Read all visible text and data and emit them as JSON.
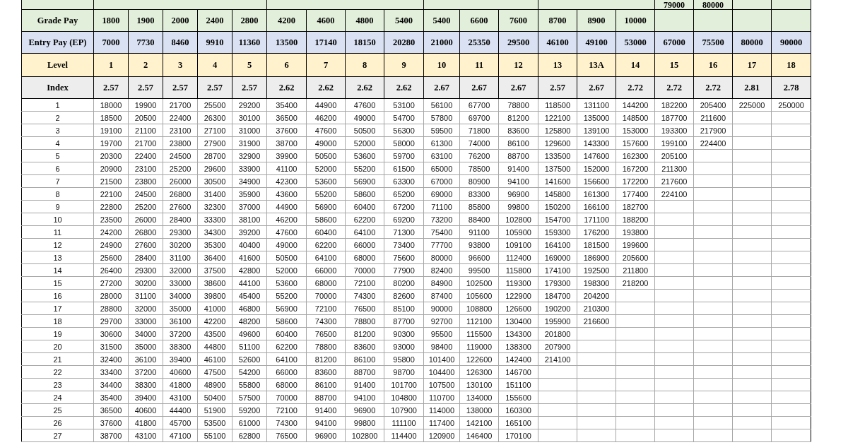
{
  "top_row": [
    "79000",
    "80000"
  ],
  "header_rows": [
    {
      "kind": "grade",
      "label": "Grade Pay",
      "values": [
        "1800",
        "1900",
        "2000",
        "2400",
        "2800",
        "4200",
        "4600",
        "4800",
        "5400",
        "5400",
        "6600",
        "7600",
        "8700",
        "8900",
        "10000"
      ]
    },
    {
      "kind": "entry",
      "label": "Entry Pay (EP)",
      "values": [
        "7000",
        "7730",
        "8460",
        "9910",
        "11360",
        "13500",
        "17140",
        "18150",
        "20280",
        "21000",
        "25350",
        "29500",
        "46100",
        "49100",
        "53000",
        "67000",
        "75500",
        "80000",
        "90000"
      ]
    },
    {
      "kind": "level",
      "label": "Level",
      "values": [
        "1",
        "2",
        "3",
        "4",
        "5",
        "6",
        "7",
        "8",
        "9",
        "10",
        "11",
        "12",
        "13",
        "13A",
        "14",
        "15",
        "16",
        "17",
        "18"
      ]
    },
    {
      "kind": "index",
      "label": "Index",
      "values": [
        "2.57",
        "2.57",
        "2.57",
        "2.57",
        "2.57",
        "2.62",
        "2.62",
        "2.62",
        "2.62",
        "2.67",
        "2.67",
        "2.67",
        "2.57",
        "2.67",
        "2.72",
        "2.72",
        "2.72",
        "2.81",
        "2.78"
      ]
    }
  ],
  "rows": [
    {
      "step": "1",
      "values": [
        "18000",
        "19900",
        "21700",
        "25500",
        "29200",
        "35400",
        "44900",
        "47600",
        "53100",
        "56100",
        "67700",
        "78800",
        "118500",
        "131100",
        "144200",
        "182200",
        "205400",
        "225000",
        "250000"
      ]
    },
    {
      "step": "2",
      "values": [
        "18500",
        "20500",
        "22400",
        "26300",
        "30100",
        "36500",
        "46200",
        "49000",
        "54700",
        "57800",
        "69700",
        "81200",
        "122100",
        "135000",
        "148500",
        "187700",
        "211600"
      ]
    },
    {
      "step": "3",
      "values": [
        "19100",
        "21100",
        "23100",
        "27100",
        "31000",
        "37600",
        "47600",
        "50500",
        "56300",
        "59500",
        "71800",
        "83600",
        "125800",
        "139100",
        "153000",
        "193300",
        "217900"
      ]
    },
    {
      "step": "4",
      "values": [
        "19700",
        "21700",
        "23800",
        "27900",
        "31900",
        "38700",
        "49000",
        "52000",
        "58000",
        "61300",
        "74000",
        "86100",
        "129600",
        "143300",
        "157600",
        "199100",
        "224400"
      ]
    },
    {
      "step": "5",
      "values": [
        "20300",
        "22400",
        "24500",
        "28700",
        "32900",
        "39900",
        "50500",
        "53600",
        "59700",
        "63100",
        "76200",
        "88700",
        "133500",
        "147600",
        "162300",
        "205100"
      ]
    },
    {
      "step": "6",
      "values": [
        "20900",
        "23100",
        "25200",
        "29600",
        "33900",
        "41100",
        "52000",
        "55200",
        "61500",
        "65000",
        "78500",
        "91400",
        "137500",
        "152000",
        "167200",
        "211300"
      ]
    },
    {
      "step": "7",
      "values": [
        "21500",
        "23800",
        "26000",
        "30500",
        "34900",
        "42300",
        "53600",
        "56900",
        "63300",
        "67000",
        "80900",
        "94100",
        "141600",
        "156600",
        "172200",
        "217600"
      ]
    },
    {
      "step": "8",
      "values": [
        "22100",
        "24500",
        "26800",
        "31400",
        "35900",
        "43600",
        "55200",
        "58600",
        "65200",
        "69000",
        "83300",
        "96900",
        "145800",
        "161300",
        "177400",
        "224100"
      ]
    },
    {
      "step": "9",
      "values": [
        "22800",
        "25200",
        "27600",
        "32300",
        "37000",
        "44900",
        "56900",
        "60400",
        "67200",
        "71100",
        "85800",
        "99800",
        "150200",
        "166100",
        "182700"
      ]
    },
    {
      "step": "10",
      "values": [
        "23500",
        "26000",
        "28400",
        "33300",
        "38100",
        "46200",
        "58600",
        "62200",
        "69200",
        "73200",
        "88400",
        "102800",
        "154700",
        "171100",
        "188200"
      ]
    },
    {
      "step": "11",
      "values": [
        "24200",
        "26800",
        "29300",
        "34300",
        "39200",
        "47600",
        "60400",
        "64100",
        "71300",
        "75400",
        "91100",
        "105900",
        "159300",
        "176200",
        "193800"
      ]
    },
    {
      "step": "12",
      "values": [
        "24900",
        "27600",
        "30200",
        "35300",
        "40400",
        "49000",
        "62200",
        "66000",
        "73400",
        "77700",
        "93800",
        "109100",
        "164100",
        "181500",
        "199600"
      ]
    },
    {
      "step": "13",
      "values": [
        "25600",
        "28400",
        "31100",
        "36400",
        "41600",
        "50500",
        "64100",
        "68000",
        "75600",
        "80000",
        "96600",
        "112400",
        "169000",
        "186900",
        "205600"
      ]
    },
    {
      "step": "14",
      "values": [
        "26400",
        "29300",
        "32000",
        "37500",
        "42800",
        "52000",
        "66000",
        "70000",
        "77900",
        "82400",
        "99500",
        "115800",
        "174100",
        "192500",
        "211800"
      ]
    },
    {
      "step": "15",
      "values": [
        "27200",
        "30200",
        "33000",
        "38600",
        "44100",
        "53600",
        "68000",
        "72100",
        "80200",
        "84900",
        "102500",
        "119300",
        "179300",
        "198300",
        "218200"
      ]
    },
    {
      "step": "16",
      "values": [
        "28000",
        "31100",
        "34000",
        "39800",
        "45400",
        "55200",
        "70000",
        "74300",
        "82600",
        "87400",
        "105600",
        "122900",
        "184700",
        "204200"
      ]
    },
    {
      "step": "17",
      "values": [
        "28800",
        "32000",
        "35000",
        "41000",
        "46800",
        "56900",
        "72100",
        "76500",
        "85100",
        "90000",
        "108800",
        "126600",
        "190200",
        "210300"
      ]
    },
    {
      "step": "18",
      "values": [
        "29700",
        "33000",
        "36100",
        "42200",
        "48200",
        "58600",
        "74300",
        "78800",
        "87700",
        "92700",
        "112100",
        "130400",
        "195900",
        "216600"
      ]
    },
    {
      "step": "19",
      "values": [
        "30600",
        "34000",
        "37200",
        "43500",
        "49600",
        "60400",
        "76500",
        "81200",
        "90300",
        "95500",
        "115500",
        "134300",
        "201800"
      ]
    },
    {
      "step": "20",
      "values": [
        "31500",
        "35000",
        "38300",
        "44800",
        "51100",
        "62200",
        "78800",
        "83600",
        "93000",
        "98400",
        "119000",
        "138300",
        "207900"
      ]
    },
    {
      "step": "21",
      "values": [
        "32400",
        "36100",
        "39400",
        "46100",
        "52600",
        "64100",
        "81200",
        "86100",
        "95800",
        "101400",
        "122600",
        "142400",
        "214100"
      ]
    },
    {
      "step": "22",
      "values": [
        "33400",
        "37200",
        "40600",
        "47500",
        "54200",
        "66000",
        "83600",
        "88700",
        "98700",
        "104400",
        "126300",
        "146700"
      ]
    },
    {
      "step": "23",
      "values": [
        "34400",
        "38300",
        "41800",
        "48900",
        "55800",
        "68000",
        "86100",
        "91400",
        "101700",
        "107500",
        "130100",
        "151100"
      ]
    },
    {
      "step": "24",
      "values": [
        "35400",
        "39400",
        "43100",
        "50400",
        "57500",
        "70000",
        "88700",
        "94100",
        "104800",
        "110700",
        "134000",
        "155600"
      ]
    },
    {
      "step": "25",
      "values": [
        "36500",
        "40600",
        "44400",
        "51900",
        "59200",
        "72100",
        "91400",
        "96900",
        "107900",
        "114000",
        "138000",
        "160300"
      ]
    },
    {
      "step": "26",
      "values": [
        "37600",
        "41800",
        "45700",
        "53500",
        "61000",
        "74300",
        "94100",
        "99800",
        "111100",
        "117400",
        "142100",
        "165100"
      ]
    },
    {
      "step": "27",
      "values": [
        "38700",
        "43100",
        "47100",
        "55100",
        "62800",
        "76500",
        "96900",
        "102800",
        "114400",
        "120900",
        "146400",
        "170100"
      ]
    }
  ]
}
